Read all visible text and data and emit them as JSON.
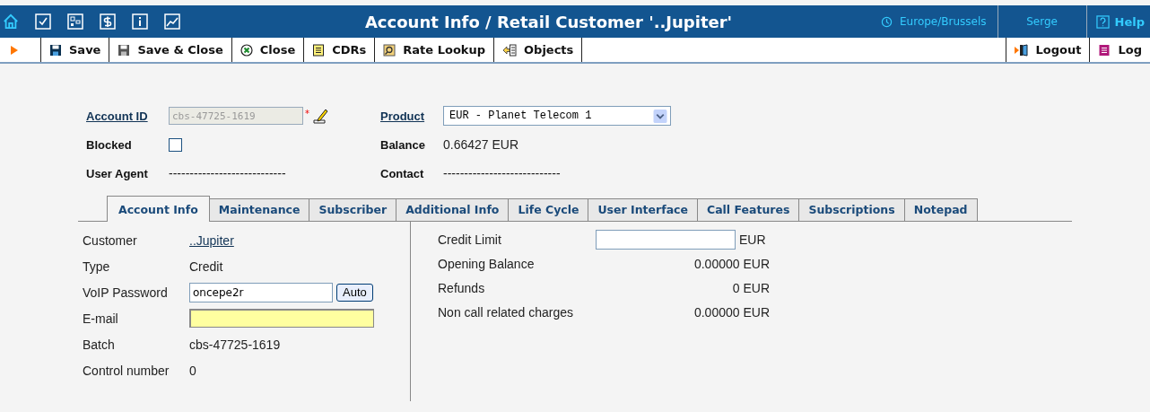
{
  "header": {
    "title": "Account Info / Retail Customer '..Jupiter'",
    "timezone": "Europe/Brussels",
    "user": "Serge",
    "help": "Help"
  },
  "toolbar": {
    "buttons": [
      "Save",
      "Save & Close",
      "Close",
      "CDRs",
      "Rate Lookup",
      "Objects"
    ],
    "right_buttons": [
      "Logout",
      "Log"
    ]
  },
  "account": {
    "account_id_label": "Account ID",
    "account_id": "cbs-47725-1619",
    "required_mark": "*",
    "product_label": "Product",
    "product": "EUR - Planet Telecom 1",
    "blocked_label": "Blocked",
    "blocked": false,
    "balance_label": "Balance",
    "balance": "0.66427 EUR",
    "user_agent_label": "User Agent",
    "user_agent": "----------------------------",
    "contact_label": "Contact",
    "contact": "----------------------------"
  },
  "tabs": [
    {
      "label": "Account Info",
      "selected": true
    },
    {
      "label": "Maintenance",
      "selected": false
    },
    {
      "label": "Subscriber",
      "selected": false
    },
    {
      "label": "Additional Info",
      "selected": false
    },
    {
      "label": "Life Cycle",
      "selected": false
    },
    {
      "label": "User Interface",
      "selected": false
    },
    {
      "label": "Call Features",
      "selected": false
    },
    {
      "label": "Subscriptions",
      "selected": false
    },
    {
      "label": "Notepad",
      "selected": false
    }
  ],
  "left_fields": [
    {
      "kind": "link",
      "label": "Customer",
      "value": "..Jupiter"
    },
    {
      "kind": "text",
      "label": "Type",
      "value": "Credit"
    },
    {
      "kind": "password",
      "label": "VoIP Password",
      "value": "oncepe2r",
      "button": "Auto"
    },
    {
      "kind": "email",
      "label": "E-mail"
    },
    {
      "kind": "text",
      "label": "Batch",
      "value": "cbs-47725-1619"
    },
    {
      "kind": "text",
      "label": "Control number",
      "value": "0"
    }
  ],
  "right_fields": [
    {
      "kind": "input",
      "label": "Credit Limit",
      "unit": "EUR"
    },
    {
      "kind": "amount",
      "label": "Opening Balance",
      "value": "0.00000 EUR"
    },
    {
      "kind": "amount",
      "label": "Refunds",
      "value": "0 EUR"
    },
    {
      "kind": "amount",
      "label": "Non call related charges",
      "value": "0.00000 EUR"
    }
  ]
}
